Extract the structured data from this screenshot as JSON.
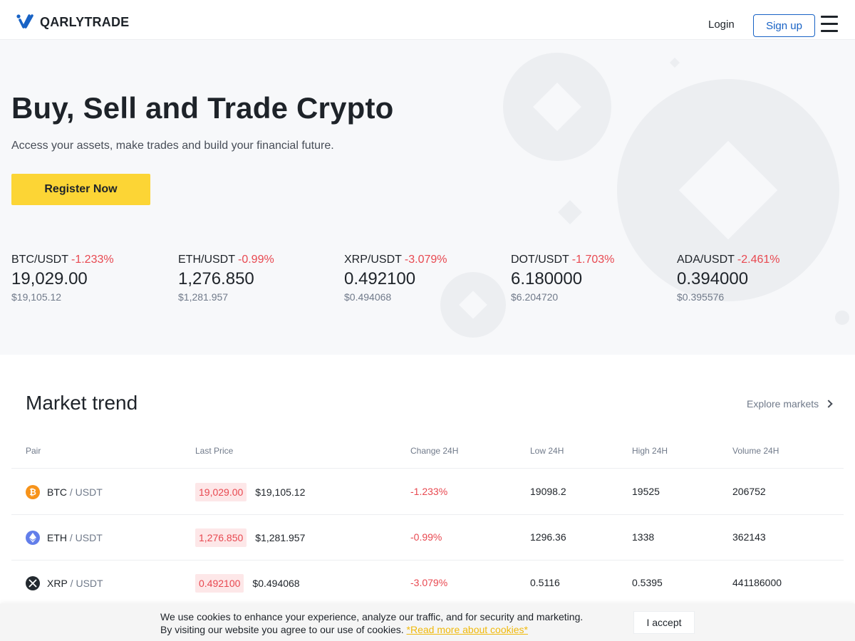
{
  "header": {
    "brand": "QARLYTRADE",
    "login": "Login",
    "signup": "Sign up"
  },
  "hero": {
    "title": "Buy, Sell and Trade Crypto",
    "subtitle": "Access your assets, make trades and build your financial future.",
    "cta": "Register Now"
  },
  "tickers": [
    {
      "pair": "BTC/USDT",
      "change": "-1.233%",
      "price": "19,029.00",
      "usd": "$19,105.12"
    },
    {
      "pair": "ETH/USDT",
      "change": "-0.99%",
      "price": "1,276.850",
      "usd": "$1,281.957"
    },
    {
      "pair": "XRP/USDT",
      "change": "-3.079%",
      "price": "0.492100",
      "usd": "$0.494068"
    },
    {
      "pair": "DOT/USDT",
      "change": "-1.703%",
      "price": "6.180000",
      "usd": "$6.204720"
    },
    {
      "pair": "ADA/USDT",
      "change": "-2.461%",
      "price": "0.394000",
      "usd": "$0.395576"
    }
  ],
  "market": {
    "title": "Market trend",
    "explore": "Explore markets",
    "columns": [
      "Pair",
      "Last Price",
      "Change 24H",
      "Low 24H",
      "High 24H",
      "Volume 24H"
    ],
    "rows": [
      {
        "base": "BTC",
        "quote": " / USDT",
        "icon": "bitcoin-icon",
        "icon_color": "#f7931a",
        "last": "19,029.00",
        "last_usd": "$19,105.12",
        "change": "-1.233%",
        "low": "19098.2",
        "high": "19525",
        "volume": "206752"
      },
      {
        "base": "ETH",
        "quote": " / USDT",
        "icon": "ethereum-icon",
        "icon_color": "#627eea",
        "last": "1,276.850",
        "last_usd": "$1,281.957",
        "change": "-0.99%",
        "low": "1296.36",
        "high": "1338",
        "volume": "362143"
      },
      {
        "base": "XRP",
        "quote": " / USDT",
        "icon": "xrp-icon",
        "icon_color": "#23292f",
        "last": "0.492100",
        "last_usd": "$0.494068",
        "change": "-3.079%",
        "low": "0.5116",
        "high": "0.5395",
        "volume": "441186000"
      }
    ]
  },
  "cookie": {
    "line1": "We use cookies to enhance your experience, analyze our traffic, and for security and marketing.",
    "line2": "By visiting our website you agree to our use of cookies.",
    "link": "*Read more about cookies*",
    "accept": "I accept"
  },
  "colors": {
    "accent": "#fcd535",
    "negative": "#e84850",
    "link_blue": "#1762c5"
  }
}
